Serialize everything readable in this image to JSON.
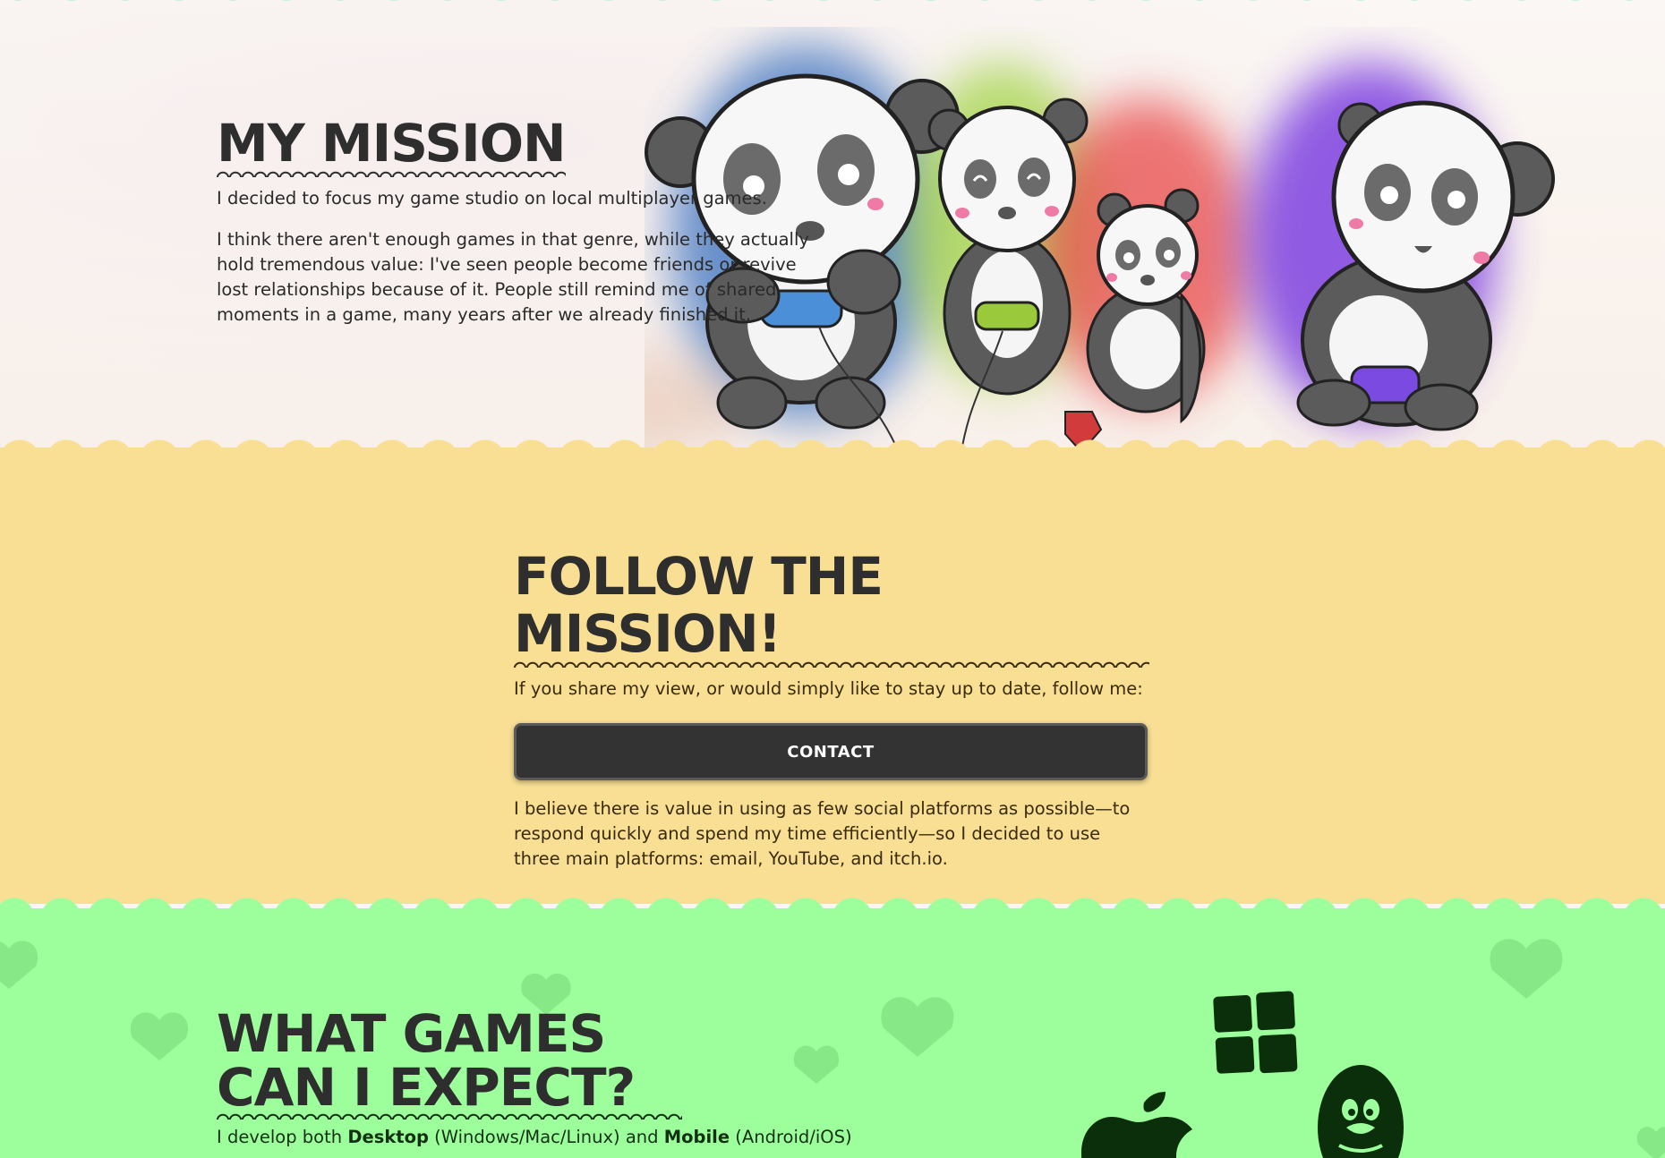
{
  "mission": {
    "title": "My Mission",
    "paragraph1": "I decided to focus my game studio on local multiplayer games.",
    "paragraph2": "I think there aren't enough games in that genre, while they actually hold tremendous value: I've seen people become friends or revive lost relationships because of it. People still remind me of shared moments in a game, many years after we already finished it.",
    "illustration_icon": "pandas-playing-games-illustration"
  },
  "follow": {
    "title": "Follow the Mission!",
    "lead": "If you share my view, or would simply like to stay up to date, follow me:",
    "contact_label": "Contact",
    "body": "I believe there is value in using as few social platforms as possible—to respond quickly and spend my time efficiently—so I decided to use three main platforms: email, YouTube, and itch.io."
  },
  "games": {
    "title": "What games can I expect?",
    "intro_prefix": "I develop both ",
    "intro_desktop": "Desktop",
    "intro_middle": " (Windows/Mac/Linux) and ",
    "intro_mobile": "Mobile",
    "intro_suffix": " (Android/iOS)",
    "platform_icons": [
      "windows-icon",
      "apple-icon",
      "linux-icon"
    ]
  },
  "colors": {
    "mission_bg": "#fbf7f4",
    "follow_bg": "#f8df94",
    "games_bg": "#9cff9c",
    "button_bg": "#333333",
    "top_scallop": "#8ef0b9"
  }
}
